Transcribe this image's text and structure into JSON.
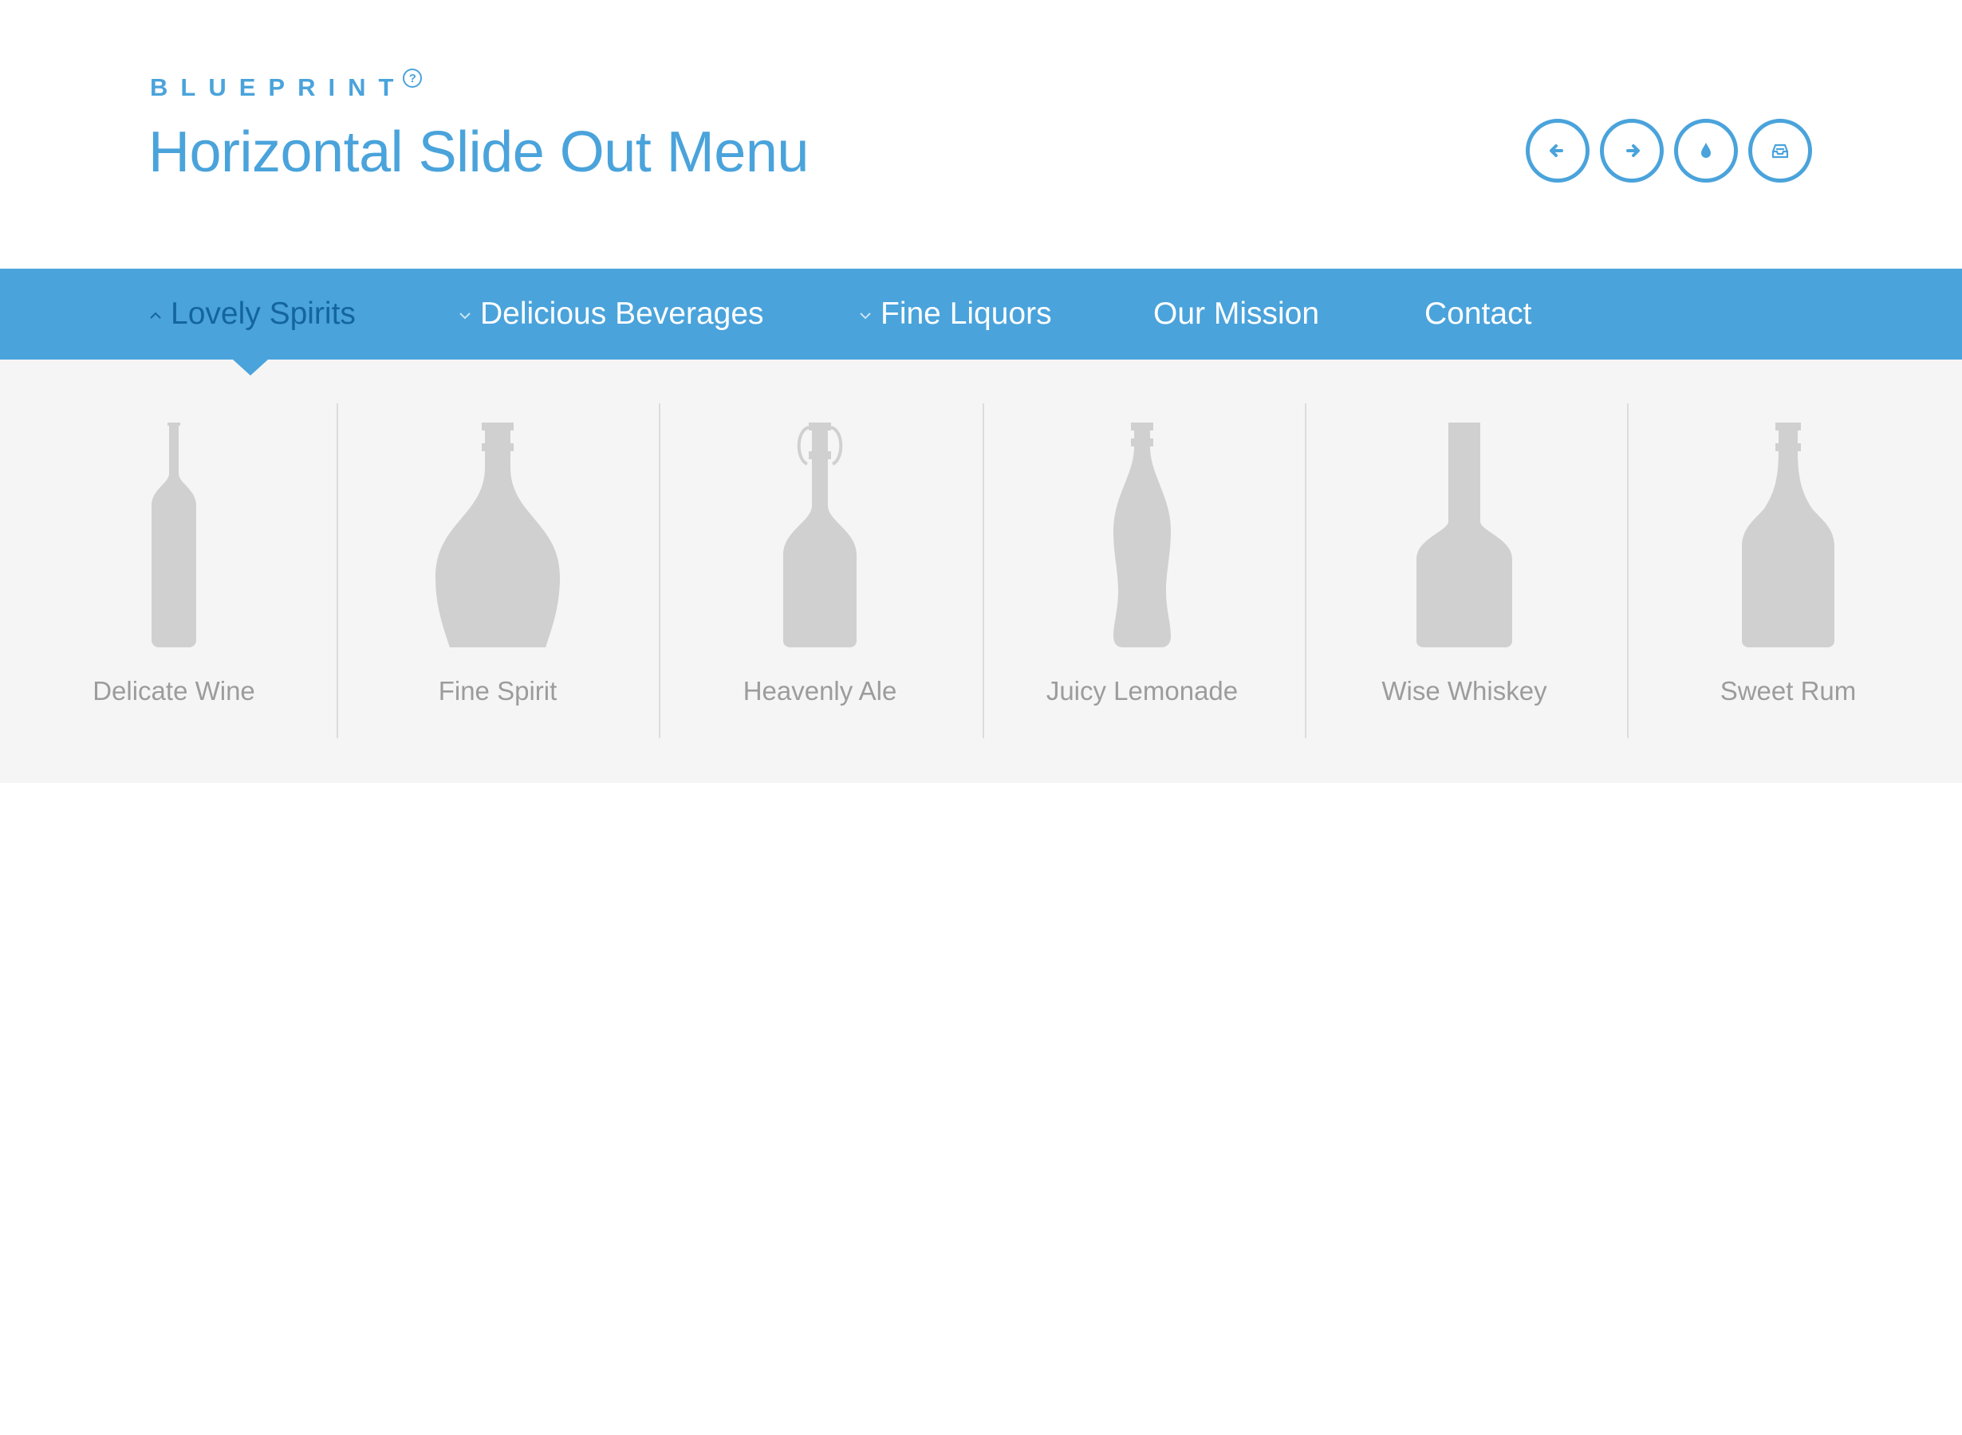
{
  "header": {
    "brand": "BLUEPRINT",
    "brand_help": "?",
    "title": "Horizontal Slide Out Menu"
  },
  "icon_buttons": [
    {
      "name": "arrow-left-icon"
    },
    {
      "name": "arrow-right-icon"
    },
    {
      "name": "drop-icon"
    },
    {
      "name": "archive-icon"
    }
  ],
  "nav": {
    "items": [
      {
        "label": "Lovely Spirits",
        "caret": "up",
        "active": true
      },
      {
        "label": "Delicious Beverages",
        "caret": "down",
        "active": false
      },
      {
        "label": "Fine Liquors",
        "caret": "down",
        "active": false
      },
      {
        "label": "Our Mission",
        "caret": "",
        "active": false
      },
      {
        "label": "Contact",
        "caret": "",
        "active": false
      }
    ]
  },
  "submenu": {
    "items": [
      {
        "label": "Delicate Wine",
        "icon": "wine-bottle-icon"
      },
      {
        "label": "Fine Spirit",
        "icon": "spirit-bottle-icon"
      },
      {
        "label": "Heavenly Ale",
        "icon": "ale-bottle-icon"
      },
      {
        "label": "Juicy Lemonade",
        "icon": "lemonade-bottle-icon"
      },
      {
        "label": "Wise Whiskey",
        "icon": "whiskey-bottle-icon"
      },
      {
        "label": "Sweet Rum",
        "icon": "rum-bottle-icon"
      }
    ]
  },
  "colors": {
    "accent": "#4aa3db",
    "active_nav": "#14659e",
    "submenu_bg": "#f5f5f5",
    "bottle": "#d0d0d0",
    "label": "#9c9c9c"
  }
}
